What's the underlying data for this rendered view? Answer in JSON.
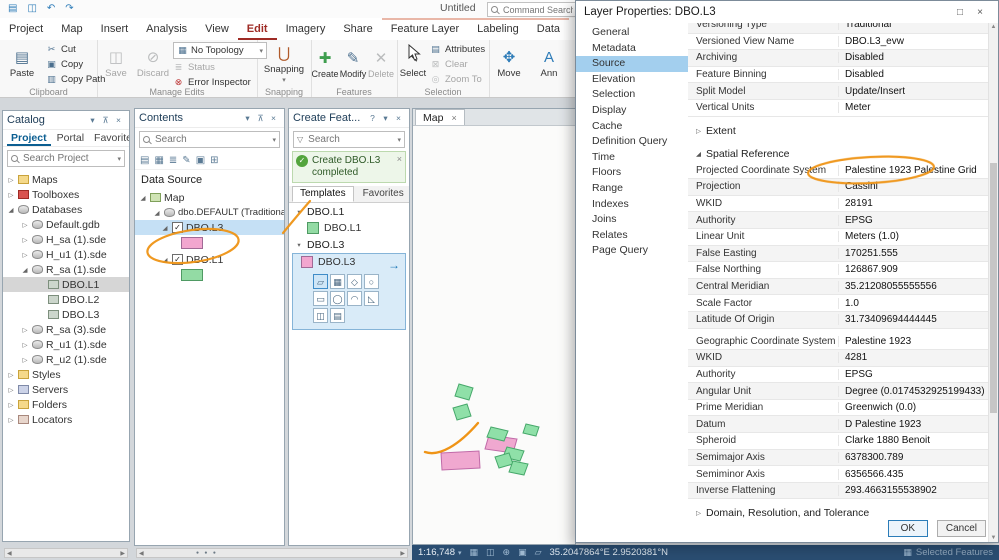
{
  "icons": {
    "close": "×",
    "menu": "▾",
    "pin": "⊼",
    "help": "?",
    "list": "≡",
    "dropdown": "▾",
    "maximize": "□",
    "expand": "▷",
    "collapse": "◢",
    "check_on": "✓",
    "active_arrow": "→",
    "funnel": "▽",
    "scroll_left": "◀",
    "scroll_right": "▶",
    "scroll_up": "▲",
    "scroll_down": "▼",
    "grip_dots": "● ● ●"
  },
  "titlebar": {
    "title": "Untitled",
    "search_placeholder": "Command Search",
    "qat_icons": [
      {
        "glyph": "▤",
        "name": "project"
      },
      {
        "glyph": "◫",
        "name": "save"
      },
      {
        "glyph": "↶",
        "name": "undo"
      },
      {
        "glyph": "↷",
        "name": "redo"
      }
    ]
  },
  "ribbon": {
    "tabs": [
      {
        "label": "Project"
      },
      {
        "label": "Map"
      },
      {
        "label": "Insert"
      },
      {
        "label": "Analysis"
      },
      {
        "label": "View"
      },
      {
        "label": "Edit",
        "cls": "active"
      },
      {
        "label": "Imagery"
      },
      {
        "label": "Share"
      },
      {
        "label": "Feature Layer",
        "cls": "ctx"
      },
      {
        "label": "Labeling",
        "cls": "ctx"
      },
      {
        "label": "Data",
        "cls": "ctx"
      }
    ],
    "clipboard": {
      "label": "Clipboard",
      "paste": "Paste",
      "cut": "Cut",
      "copy": "Copy",
      "copy_path": "Copy Path",
      "paste_icon": "▤",
      "cut_icon": "✂",
      "copy_icon": "▣",
      "copy_path_icon": "▥"
    },
    "manage": {
      "label": "Manage Edits",
      "save": "Save",
      "discard": "Discard",
      "topology": "No Topology",
      "status": "Status",
      "error": "Error Inspector",
      "save_icon": "◫",
      "discard_icon": "⊘",
      "topology_icon": "▦",
      "status_icon": "≣",
      "error_icon": "⊗"
    },
    "snapping": {
      "label": "Snapping",
      "button": "Snapping",
      "icon": "⋃"
    },
    "features": {
      "label": "Features",
      "create": "Create",
      "modify": "Modify",
      "delete": "Delete",
      "create_icon": "✚",
      "modify_icon": "✎",
      "delete_icon": "✕"
    },
    "selection": {
      "label": "Selection",
      "select": "Select",
      "attributes": "Attributes",
      "clear": "Clear",
      "zoom": "Zoom To",
      "select_icon": "↖",
      "attributes_icon": "▤",
      "clear_icon": "⊠",
      "zoom_icon": "◎"
    },
    "extra": {
      "move": "Move",
      "ann": "Ann",
      "move_icon": "✥",
      "ann_icon": "A"
    }
  },
  "catalog": {
    "title": "Catalog",
    "tabs": [
      {
        "label": "Project",
        "cls": "active"
      },
      {
        "label": "Portal"
      },
      {
        "label": "Favorites"
      }
    ],
    "search_placeholder": "Search Project",
    "tree": [
      {
        "arrow": "▷",
        "icon": "ic-folder",
        "label": "Maps",
        "cls": "d0"
      },
      {
        "arrow": "▷",
        "icon": "ic-toolbox",
        "label": "Toolboxes",
        "cls": "d0"
      },
      {
        "arrow": "◢",
        "icon": "ic-dbg",
        "label": "Databases",
        "cls": "d0"
      },
      {
        "arrow": "▷",
        "icon": "ic-db",
        "label": "Default.gdb",
        "cls": "d1"
      },
      {
        "arrow": "▷",
        "icon": "ic-db",
        "label": "H_sa (1).sde",
        "cls": "d1"
      },
      {
        "arrow": "▷",
        "icon": "ic-db",
        "label": "H_u1 (1).sde",
        "cls": "d1"
      },
      {
        "arrow": "◢",
        "icon": "ic-db",
        "label": "R_sa (1).sde",
        "cls": "d1"
      },
      {
        "arrow": "",
        "icon": "ic-fc",
        "label": "DBO.L1",
        "cls": "d2 selected"
      },
      {
        "arrow": "",
        "icon": "ic-fc",
        "label": "DBO.L2",
        "cls": "d2"
      },
      {
        "arrow": "",
        "icon": "ic-fc",
        "label": "DBO.L3",
        "cls": "d2"
      },
      {
        "arrow": "▷",
        "icon": "ic-db",
        "label": "R_sa (3).sde",
        "cls": "d1"
      },
      {
        "arrow": "▷",
        "icon": "ic-db",
        "label": "R_u1 (1).sde",
        "cls": "d1"
      },
      {
        "arrow": "▷",
        "icon": "ic-db",
        "label": "R_u2 (1).sde",
        "cls": "d1"
      },
      {
        "arrow": "▷",
        "icon": "ic-folder",
        "label": "Styles",
        "cls": "d0"
      },
      {
        "arrow": "▷",
        "icon": "ic-server",
        "label": "Servers",
        "cls": "d0"
      },
      {
        "arrow": "▷",
        "icon": "ic-folder",
        "label": "Folders",
        "cls": "d0"
      },
      {
        "arrow": "▷",
        "icon": "ic-locator",
        "label": "Locators",
        "cls": "d0"
      }
    ]
  },
  "contents": {
    "title": "Contents",
    "search_placeholder": "Search",
    "heading": "Data Source",
    "toolbar_icons": [
      "▤",
      "▦",
      "≣",
      "✎",
      "▣",
      "⊞"
    ],
    "map_item": "Map",
    "workspace_item": "dbo.DEFAULT (Traditional) - s",
    "layer3": "DBO.L3",
    "layer1": "DBO.L1"
  },
  "create_features": {
    "title": "Create Feat...",
    "search_placeholder": "Search",
    "notif_line1": "Create DBO.L3",
    "notif_line2": "completed",
    "tabs": [
      {
        "label": "Templates",
        "cls": "active"
      },
      {
        "label": "Favorites"
      }
    ],
    "group1": "DBO.L1",
    "item1": "DBO.L1",
    "group2": "DBO.L3",
    "item2": "DBO.L3",
    "palette": [
      "▱",
      "▦",
      "◇",
      "○",
      "▭",
      "◯",
      "◠",
      "◺",
      "◫",
      "▤"
    ]
  },
  "map": {
    "tab": "Map"
  },
  "dialog": {
    "title": "Layer Properties: DBO.L3",
    "nav": [
      {
        "label": "General"
      },
      {
        "label": "Metadata"
      },
      {
        "label": "Source",
        "cls": "selected"
      },
      {
        "label": "Elevation"
      },
      {
        "label": "Selection"
      },
      {
        "label": "Display"
      },
      {
        "label": "Cache"
      },
      {
        "label": "Definition Query"
      },
      {
        "label": "Time"
      },
      {
        "label": "Floors"
      },
      {
        "label": "Range"
      },
      {
        "label": "Indexes"
      },
      {
        "label": "Joins"
      },
      {
        "label": "Relates"
      },
      {
        "label": "Page Query"
      }
    ],
    "top_rows": [
      {
        "label": "Versioning Type",
        "value": "Traditional"
      },
      {
        "label": "Versioned View Name",
        "value": "DBO.L3_evw"
      },
      {
        "label": "Archiving",
        "value": "Disabled"
      },
      {
        "label": "Feature Binning",
        "value": "Disabled"
      },
      {
        "label": "Split Model",
        "value": "Update/Insert"
      },
      {
        "label": "Vertical Units",
        "value": "Meter"
      }
    ],
    "sections": {
      "extent": "Extent",
      "spatial_reference": "Spatial Reference",
      "domain": "Domain, Resolution, and Tolerance"
    },
    "sr_rows": [
      {
        "label": "Projected Coordinate System",
        "value": "Palestine 1923 Palestine Grid"
      },
      {
        "label": "Projection",
        "value": "Cassini"
      },
      {
        "label": "WKID",
        "value": "28191"
      },
      {
        "label": "Authority",
        "value": "EPSG"
      },
      {
        "label": "Linear Unit",
        "value": "Meters (1.0)"
      },
      {
        "label": "False Easting",
        "value": "170251.555"
      },
      {
        "label": "False Northing",
        "value": "126867.909"
      },
      {
        "label": "Central Meridian",
        "value": "35.21208055555556"
      },
      {
        "label": "Scale Factor",
        "value": "1.0"
      },
      {
        "label": "Latitude Of Origin",
        "value": "31.73409694444445"
      }
    ],
    "gcs_rows": [
      {
        "label": "Geographic Coordinate System",
        "value": "Palestine 1923"
      },
      {
        "label": "WKID",
        "value": "4281"
      },
      {
        "label": "Authority",
        "value": "EPSG"
      },
      {
        "label": "Angular Unit",
        "value": "Degree (0.0174532925199433)"
      },
      {
        "label": "Prime Meridian",
        "value": "Greenwich (0.0)"
      },
      {
        "label": "Datum",
        "value": "D Palestine 1923"
      },
      {
        "label": "Spheroid",
        "value": "Clarke 1880 Benoit"
      },
      {
        "label": "Semimajor Axis",
        "value": "6378300.789"
      },
      {
        "label": "Semiminor Axis",
        "value": "6356566.435"
      },
      {
        "label": "Inverse Flattening",
        "value": "293.4663155538902"
      }
    ],
    "ok": "OK",
    "cancel": "Cancel"
  },
  "statusbar": {
    "scale": "1:16,748",
    "icons": [
      "▦",
      "◫",
      "⊕",
      "▣",
      "▱"
    ],
    "coordinates": "35.2047864°E  2.9520381°N",
    "right_label": "Selected Features",
    "right_icon": "▦"
  }
}
